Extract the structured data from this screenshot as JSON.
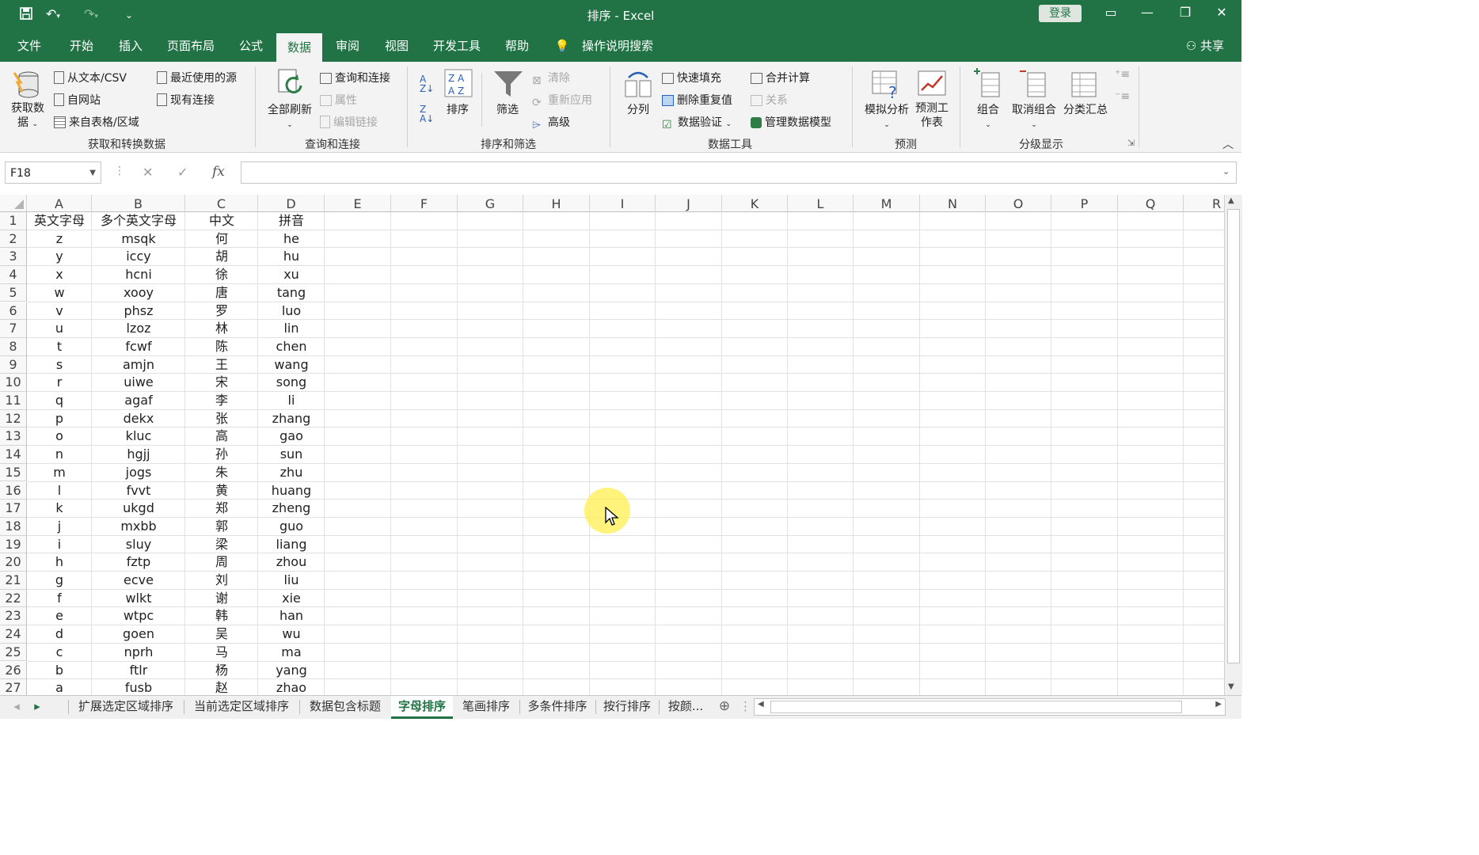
{
  "window": {
    "title": "排序 - Excel",
    "login": "登录"
  },
  "tabs": [
    "文件",
    "开始",
    "插入",
    "页面布局",
    "公式",
    "数据",
    "审阅",
    "视图",
    "开发工具",
    "帮助"
  ],
  "search_hint": "操作说明搜索",
  "share": "共享",
  "ribbon": {
    "get_data": "获取数据",
    "from_text": "从文本/CSV",
    "from_web": "自网站",
    "from_table": "来自表格/区域",
    "recent_sources": "最近使用的源",
    "existing_conn": "现有连接",
    "group_get": "获取和转换数据",
    "refresh_all": "全部刷新",
    "query_conn": "查询和连接",
    "properties": "属性",
    "edit_links": "编辑链接",
    "group_query": "查询和连接",
    "sort": "排序",
    "filter": "筛选",
    "clear": "清除",
    "reapply": "重新应用",
    "advanced": "高级",
    "group_sort": "排序和筛选",
    "text_to_cols": "分列",
    "flash_fill": "快速填充",
    "remove_dup": "删除重复值",
    "data_validation": "数据验证",
    "consolidate": "合并计算",
    "relationships": "关系",
    "manage_model": "管理数据模型",
    "group_tools": "数据工具",
    "what_if": "模拟分析",
    "forecast_sheet": "预测工作表",
    "group_forecast": "预测",
    "group_btn": "组合",
    "ungroup": "取消组合",
    "subtotal": "分类汇总",
    "group_outline": "分级显示"
  },
  "formula_bar": {
    "name_box": "F18",
    "formula": "",
    "fx": "fx"
  },
  "columns": [
    "A",
    "B",
    "C",
    "D",
    "E",
    "F",
    "G",
    "H",
    "I",
    "J",
    "K",
    "L",
    "M",
    "N",
    "O",
    "P",
    "Q",
    "R"
  ],
  "rows": [
    [
      "英文字母",
      "多个英文字母",
      "中文",
      "拼音"
    ],
    [
      "z",
      "msqk",
      "何",
      "he"
    ],
    [
      "y",
      "iccy",
      "胡",
      "hu"
    ],
    [
      "x",
      "hcni",
      "徐",
      "xu"
    ],
    [
      "w",
      "xooy",
      "唐",
      "tang"
    ],
    [
      "v",
      "phsz",
      "罗",
      "luo"
    ],
    [
      "u",
      "lzoz",
      "林",
      "lin"
    ],
    [
      "t",
      "fcwf",
      "陈",
      "chen"
    ],
    [
      "s",
      "amjn",
      "王",
      "wang"
    ],
    [
      "r",
      "uiwe",
      "宋",
      "song"
    ],
    [
      "q",
      "agaf",
      "李",
      "li"
    ],
    [
      "p",
      "dekx",
      "张",
      "zhang"
    ],
    [
      "o",
      "kluc",
      "高",
      "gao"
    ],
    [
      "n",
      "hgjj",
      "孙",
      "sun"
    ],
    [
      "m",
      "jogs",
      "朱",
      "zhu"
    ],
    [
      "l",
      "fvvt",
      "黄",
      "huang"
    ],
    [
      "k",
      "ukgd",
      "郑",
      "zheng"
    ],
    [
      "j",
      "mxbb",
      "郭",
      "guo"
    ],
    [
      "i",
      "sluy",
      "梁",
      "liang"
    ],
    [
      "h",
      "fztp",
      "周",
      "zhou"
    ],
    [
      "g",
      "ecve",
      "刘",
      "liu"
    ],
    [
      "f",
      "wlkt",
      "谢",
      "xie"
    ],
    [
      "e",
      "wtpc",
      "韩",
      "han"
    ],
    [
      "d",
      "goen",
      "吴",
      "wu"
    ],
    [
      "c",
      "nprh",
      "马",
      "ma"
    ],
    [
      "b",
      "ftlr",
      "杨",
      "yang"
    ],
    [
      "a",
      "fusb",
      "赵",
      "zhao"
    ]
  ],
  "sheets": [
    "扩展选定区域排序",
    "当前选定区域排序",
    "数据包含标题",
    "字母排序",
    "笔画排序",
    "多条件排序",
    "按行排序",
    "按颜..."
  ],
  "active_sheet": "字母排序",
  "colors": {
    "brand": "#217346"
  }
}
